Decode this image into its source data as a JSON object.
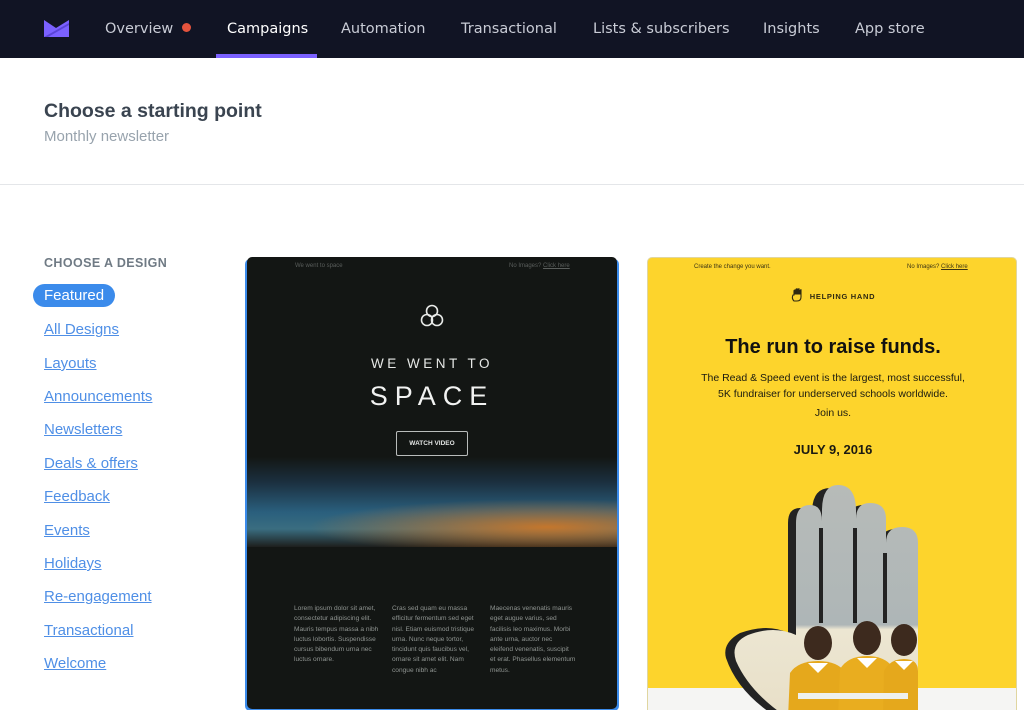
{
  "nav": {
    "logo": "mail-envelope-logo",
    "items": [
      {
        "label": "Overview",
        "has_dot": true,
        "dot_color": "#e5533d"
      },
      {
        "label": "Campaigns",
        "active": true
      },
      {
        "label": "Automation"
      },
      {
        "label": "Transactional"
      },
      {
        "label": "Lists & subscribers"
      },
      {
        "label": "Insights"
      },
      {
        "label": "App store"
      }
    ],
    "accent_color": "#7b61ff"
  },
  "header": {
    "title": "Choose a starting point",
    "subtitle": "Monthly newsletter"
  },
  "sidebar": {
    "heading": "CHOOSE A DESIGN",
    "items": [
      {
        "label": "Featured",
        "active": true
      },
      {
        "label": "All Designs"
      },
      {
        "label": "Layouts"
      },
      {
        "label": "Announcements"
      },
      {
        "label": "Newsletters"
      },
      {
        "label": "Deals & offers"
      },
      {
        "label": "Feedback"
      },
      {
        "label": "Events"
      },
      {
        "label": "Holidays"
      },
      {
        "label": "Re-engagement"
      },
      {
        "label": "Transactional"
      },
      {
        "label": "Welcome"
      }
    ],
    "active_color": "#3b8beb",
    "link_color": "#4f8fe6"
  },
  "templates": {
    "space": {
      "preheader": "We went to space",
      "no_images": "No Images?",
      "click_here": "Click here",
      "kicker": "WE WENT TO",
      "title": "SPACE",
      "button": "WATCH VIDEO",
      "columns": [
        "Lorem ipsum dolor sit amet, consectetur adipiscing elit. Mauris tempus massa a nibh luctus lobortis. Suspendisse cursus bibendum urna nec luctus ornare.",
        "Cras sed quam eu massa efficitur fermentum sed eget nisl. Etiam euismod tristique urna. Nunc neque tortor, tincidunt quis faucibus vel, ornare sit amet elit. Nam congue nibh ac",
        "Maecenas venenatis mauris eget augue varius, sed facilisis leo maximus. Morbi ante urna, auctor nec eleifend venenatis, suscipit et erat. Phasellus elementum metus."
      ],
      "selected": true
    },
    "helping_hand": {
      "preheader": "Create the change you want.",
      "no_images": "No Images?",
      "click_here": "Click here",
      "brand": "HELPING HAND",
      "title": "The run to raise funds.",
      "body_line1": "The Read & Speed event is the largest, most successful,",
      "body_line2": "5K fundraiser for underserved schools worldwide.",
      "join": "Join us.",
      "date": "JULY 9, 2016",
      "bg_color": "#fdd42c"
    }
  }
}
